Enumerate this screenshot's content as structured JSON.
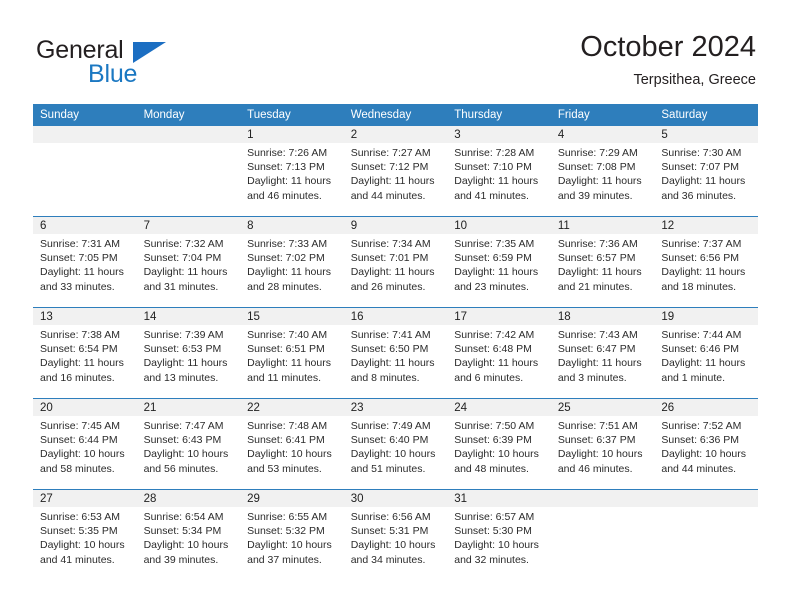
{
  "brand": {
    "name_part1": "General",
    "name_part2": "Blue",
    "accent_color": "#1b6ec2"
  },
  "header": {
    "title": "October 2024",
    "location": "Terpsithea, Greece"
  },
  "calendar": {
    "header_bg": "#2e7ebc",
    "daynum_bg": "#f1f1f1",
    "weekday_headers": [
      "Sunday",
      "Monday",
      "Tuesday",
      "Wednesday",
      "Thursday",
      "Friday",
      "Saturday"
    ],
    "weeks": [
      [
        {
          "day": "",
          "sunrise": "",
          "sunset": "",
          "daylight1": "",
          "daylight2": ""
        },
        {
          "day": "",
          "sunrise": "",
          "sunset": "",
          "daylight1": "",
          "daylight2": ""
        },
        {
          "day": "1",
          "sunrise": "Sunrise: 7:26 AM",
          "sunset": "Sunset: 7:13 PM",
          "daylight1": "Daylight: 11 hours",
          "daylight2": "and 46 minutes."
        },
        {
          "day": "2",
          "sunrise": "Sunrise: 7:27 AM",
          "sunset": "Sunset: 7:12 PM",
          "daylight1": "Daylight: 11 hours",
          "daylight2": "and 44 minutes."
        },
        {
          "day": "3",
          "sunrise": "Sunrise: 7:28 AM",
          "sunset": "Sunset: 7:10 PM",
          "daylight1": "Daylight: 11 hours",
          "daylight2": "and 41 minutes."
        },
        {
          "day": "4",
          "sunrise": "Sunrise: 7:29 AM",
          "sunset": "Sunset: 7:08 PM",
          "daylight1": "Daylight: 11 hours",
          "daylight2": "and 39 minutes."
        },
        {
          "day": "5",
          "sunrise": "Sunrise: 7:30 AM",
          "sunset": "Sunset: 7:07 PM",
          "daylight1": "Daylight: 11 hours",
          "daylight2": "and 36 minutes."
        }
      ],
      [
        {
          "day": "6",
          "sunrise": "Sunrise: 7:31 AM",
          "sunset": "Sunset: 7:05 PM",
          "daylight1": "Daylight: 11 hours",
          "daylight2": "and 33 minutes."
        },
        {
          "day": "7",
          "sunrise": "Sunrise: 7:32 AM",
          "sunset": "Sunset: 7:04 PM",
          "daylight1": "Daylight: 11 hours",
          "daylight2": "and 31 minutes."
        },
        {
          "day": "8",
          "sunrise": "Sunrise: 7:33 AM",
          "sunset": "Sunset: 7:02 PM",
          "daylight1": "Daylight: 11 hours",
          "daylight2": "and 28 minutes."
        },
        {
          "day": "9",
          "sunrise": "Sunrise: 7:34 AM",
          "sunset": "Sunset: 7:01 PM",
          "daylight1": "Daylight: 11 hours",
          "daylight2": "and 26 minutes."
        },
        {
          "day": "10",
          "sunrise": "Sunrise: 7:35 AM",
          "sunset": "Sunset: 6:59 PM",
          "daylight1": "Daylight: 11 hours",
          "daylight2": "and 23 minutes."
        },
        {
          "day": "11",
          "sunrise": "Sunrise: 7:36 AM",
          "sunset": "Sunset: 6:57 PM",
          "daylight1": "Daylight: 11 hours",
          "daylight2": "and 21 minutes."
        },
        {
          "day": "12",
          "sunrise": "Sunrise: 7:37 AM",
          "sunset": "Sunset: 6:56 PM",
          "daylight1": "Daylight: 11 hours",
          "daylight2": "and 18 minutes."
        }
      ],
      [
        {
          "day": "13",
          "sunrise": "Sunrise: 7:38 AM",
          "sunset": "Sunset: 6:54 PM",
          "daylight1": "Daylight: 11 hours",
          "daylight2": "and 16 minutes."
        },
        {
          "day": "14",
          "sunrise": "Sunrise: 7:39 AM",
          "sunset": "Sunset: 6:53 PM",
          "daylight1": "Daylight: 11 hours",
          "daylight2": "and 13 minutes."
        },
        {
          "day": "15",
          "sunrise": "Sunrise: 7:40 AM",
          "sunset": "Sunset: 6:51 PM",
          "daylight1": "Daylight: 11 hours",
          "daylight2": "and 11 minutes."
        },
        {
          "day": "16",
          "sunrise": "Sunrise: 7:41 AM",
          "sunset": "Sunset: 6:50 PM",
          "daylight1": "Daylight: 11 hours",
          "daylight2": "and 8 minutes."
        },
        {
          "day": "17",
          "sunrise": "Sunrise: 7:42 AM",
          "sunset": "Sunset: 6:48 PM",
          "daylight1": "Daylight: 11 hours",
          "daylight2": "and 6 minutes."
        },
        {
          "day": "18",
          "sunrise": "Sunrise: 7:43 AM",
          "sunset": "Sunset: 6:47 PM",
          "daylight1": "Daylight: 11 hours",
          "daylight2": "and 3 minutes."
        },
        {
          "day": "19",
          "sunrise": "Sunrise: 7:44 AM",
          "sunset": "Sunset: 6:46 PM",
          "daylight1": "Daylight: 11 hours",
          "daylight2": "and 1 minute."
        }
      ],
      [
        {
          "day": "20",
          "sunrise": "Sunrise: 7:45 AM",
          "sunset": "Sunset: 6:44 PM",
          "daylight1": "Daylight: 10 hours",
          "daylight2": "and 58 minutes."
        },
        {
          "day": "21",
          "sunrise": "Sunrise: 7:47 AM",
          "sunset": "Sunset: 6:43 PM",
          "daylight1": "Daylight: 10 hours",
          "daylight2": "and 56 minutes."
        },
        {
          "day": "22",
          "sunrise": "Sunrise: 7:48 AM",
          "sunset": "Sunset: 6:41 PM",
          "daylight1": "Daylight: 10 hours",
          "daylight2": "and 53 minutes."
        },
        {
          "day": "23",
          "sunrise": "Sunrise: 7:49 AM",
          "sunset": "Sunset: 6:40 PM",
          "daylight1": "Daylight: 10 hours",
          "daylight2": "and 51 minutes."
        },
        {
          "day": "24",
          "sunrise": "Sunrise: 7:50 AM",
          "sunset": "Sunset: 6:39 PM",
          "daylight1": "Daylight: 10 hours",
          "daylight2": "and 48 minutes."
        },
        {
          "day": "25",
          "sunrise": "Sunrise: 7:51 AM",
          "sunset": "Sunset: 6:37 PM",
          "daylight1": "Daylight: 10 hours",
          "daylight2": "and 46 minutes."
        },
        {
          "day": "26",
          "sunrise": "Sunrise: 7:52 AM",
          "sunset": "Sunset: 6:36 PM",
          "daylight1": "Daylight: 10 hours",
          "daylight2": "and 44 minutes."
        }
      ],
      [
        {
          "day": "27",
          "sunrise": "Sunrise: 6:53 AM",
          "sunset": "Sunset: 5:35 PM",
          "daylight1": "Daylight: 10 hours",
          "daylight2": "and 41 minutes."
        },
        {
          "day": "28",
          "sunrise": "Sunrise: 6:54 AM",
          "sunset": "Sunset: 5:34 PM",
          "daylight1": "Daylight: 10 hours",
          "daylight2": "and 39 minutes."
        },
        {
          "day": "29",
          "sunrise": "Sunrise: 6:55 AM",
          "sunset": "Sunset: 5:32 PM",
          "daylight1": "Daylight: 10 hours",
          "daylight2": "and 37 minutes."
        },
        {
          "day": "30",
          "sunrise": "Sunrise: 6:56 AM",
          "sunset": "Sunset: 5:31 PM",
          "daylight1": "Daylight: 10 hours",
          "daylight2": "and 34 minutes."
        },
        {
          "day": "31",
          "sunrise": "Sunrise: 6:57 AM",
          "sunset": "Sunset: 5:30 PM",
          "daylight1": "Daylight: 10 hours",
          "daylight2": "and 32 minutes."
        },
        {
          "day": "",
          "sunrise": "",
          "sunset": "",
          "daylight1": "",
          "daylight2": ""
        },
        {
          "day": "",
          "sunrise": "",
          "sunset": "",
          "daylight1": "",
          "daylight2": ""
        }
      ]
    ]
  }
}
